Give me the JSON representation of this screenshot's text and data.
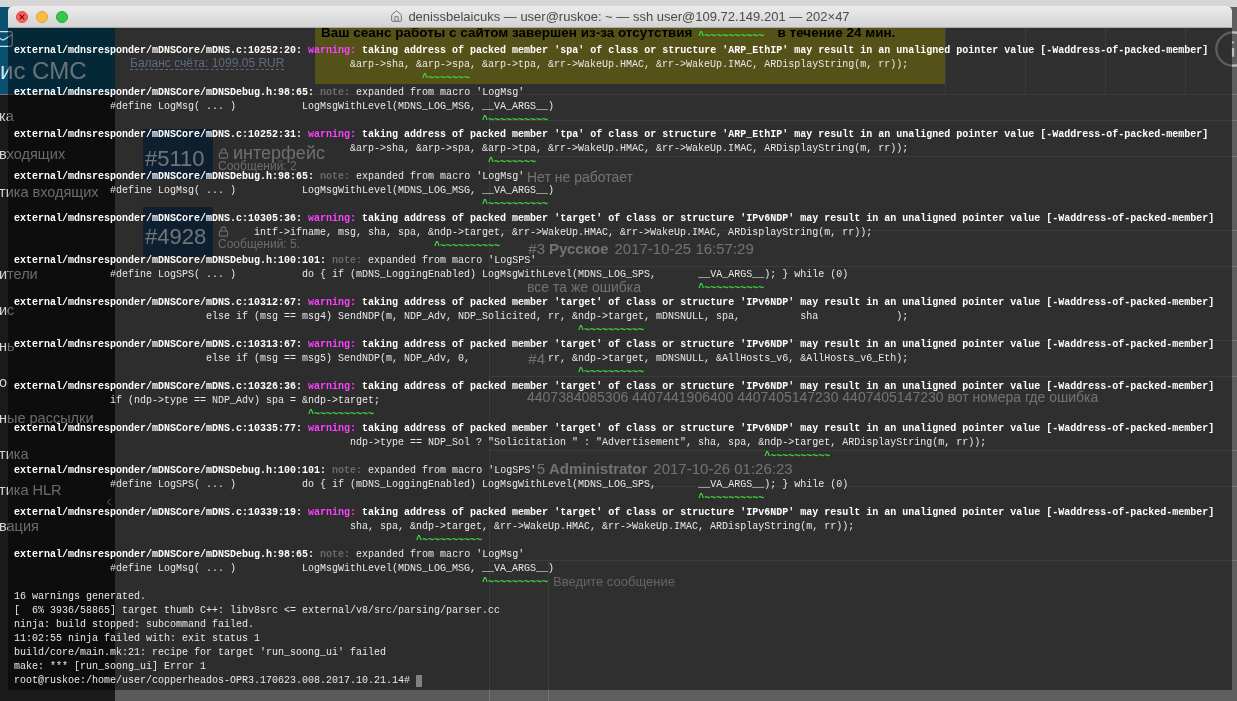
{
  "browser": {
    "logo": "ис СМС",
    "account": {
      "balance": "Баланс счёта: 1099.05 RUR"
    },
    "banner": {
      "texts": [
        "Ваш сеанс работы с сайтом завершен из-за отсутствия",
        "в течение 24 мин."
      ]
    },
    "sidebar": {
      "sections": [
        {
          "items": [
            "ка",
            "входящих",
            "тика входящих"
          ]
        },
        {
          "items": [
            "ители",
            "ис",
            "нь",
            "о",
            "ные рассылки",
            "тика",
            "тика HLR",
            "вация"
          ]
        }
      ]
    },
    "tickets": [
      {
        "number": "#5110",
        "title": "интерфейс",
        "locked": true,
        "count": "Сообщений: 2"
      },
      {
        "number": "#4928",
        "locked": true,
        "count": "Сообщений: 5."
      }
    ],
    "messages": [
      {
        "text": "Нет не работает"
      },
      {
        "number": "#3",
        "author": "Русское",
        "date": "2017-10-25 16:57:29",
        "text": "все та же ошибка"
      },
      {
        "number": "#4",
        "text": "4407384085306 4407441906400 4407405147230 4407405147230 вот номера где ошибка"
      },
      {
        "number": "5",
        "author": "Administrator",
        "date": "2017-10-26 01:26:23"
      }
    ],
    "composer": {
      "placeholder": "Введите сообщение"
    }
  },
  "terminal": {
    "title": "denissbelaicuks — user@ruskoe: ~ — ssh user@109.72.149.201 — 202×47",
    "lines": [
      {
        "kind": "caret",
        "text": "                                                                                                                  ^~~~~~~~~~~"
      },
      {
        "kind": "warning",
        "location": "external/mdnsresponder/mDNSCore/mDNS.c:10252:20:",
        "label": "warning:",
        "message": "taking address of packed member 'spa' of class or structure 'ARP_EthIP' may result in an unaligned pointer value [-Waddress-of-packed-member]"
      },
      {
        "kind": "code",
        "text": "                                                        &arp->sha, &arp->spa, &arp->tpa, &rr->WakeUp.HMAC, &rr->WakeUp.IMAC, ARDisplayString(m, rr));"
      },
      {
        "kind": "caret",
        "text": "                                                                    ^~~~~~~~"
      },
      {
        "kind": "note",
        "location": "external/mdnsresponder/mDNSCore/mDNSDebug.h:98:65:",
        "label": "note:",
        "message": "expanded from macro 'LogMsg'"
      },
      {
        "kind": "code",
        "text": "                #define LogMsg( ... )           LogMsgWithLevel(MDNS_LOG_MSG, __VA_ARGS__)"
      },
      {
        "kind": "caret",
        "text": "                                                                              ^~~~~~~~~~~"
      },
      {
        "kind": "warning",
        "location": "external/mdnsresponder/mDNSCore/mDNS.c:10252:31:",
        "label": "warning:",
        "message": "taking address of packed member 'tpa' of class or structure 'ARP_EthIP' may result in an unaligned pointer value [-Waddress-of-packed-member]"
      },
      {
        "kind": "code",
        "text": "                                                        &arp->sha, &arp->spa, &arp->tpa, &rr->WakeUp.HMAC, &rr->WakeUp.IMAC, ARDisplayString(m, rr));"
      },
      {
        "kind": "caret",
        "text": "                                                                               ^~~~~~~~"
      },
      {
        "kind": "note",
        "location": "external/mdnsresponder/mDNSCore/mDNSDebug.h:98:65:",
        "label": "note:",
        "message": "expanded from macro 'LogMsg'"
      },
      {
        "kind": "code",
        "text": "                #define LogMsg( ... )           LogMsgWithLevel(MDNS_LOG_MSG, __VA_ARGS__)"
      },
      {
        "kind": "caret",
        "text": "                                                                              ^~~~~~~~~~~"
      },
      {
        "kind": "warning",
        "location": "external/mdnsresponder/mDNSCore/mDNS.c:10305:36:",
        "label": "warning:",
        "message": "taking address of packed member 'target' of class or structure 'IPv6NDP' may result in an unaligned pointer value [-Waddress-of-packed-member]"
      },
      {
        "kind": "code",
        "text": "                                        intf->ifname, msg, sha, spa, &ndp->target, &rr->WakeUp.HMAC, &rr->WakeUp.IMAC, ARDisplayString(m, rr));"
      },
      {
        "kind": "caret",
        "text": "                                                                      ^~~~~~~~~~~"
      },
      {
        "kind": "note",
        "location": "external/mdnsresponder/mDNSCore/mDNSDebug.h:100:101:",
        "label": "note:",
        "message": "expanded from macro 'LogSPS'"
      },
      {
        "kind": "code",
        "text": "                #define LogSPS( ... )           do { if (mDNS_LoggingEnabled) LogMsgWithLevel(MDNS_LOG_SPS,       __VA_ARGS__); } while (0)"
      },
      {
        "kind": "caret",
        "text": "                                                                                                                  ^~~~~~~~~~~"
      },
      {
        "kind": "warning",
        "location": "external/mdnsresponder/mDNSCore/mDNS.c:10312:67:",
        "label": "warning:",
        "message": "taking address of packed member 'target' of class or structure 'IPv6NDP' may result in an unaligned pointer value [-Waddress-of-packed-member]"
      },
      {
        "kind": "code",
        "text": "                                else if (msg == msg4) SendNDP(m, NDP_Adv, NDP_Solicited, rr, &ndp->target, mDNSNULL, spa,          sha             );"
      },
      {
        "kind": "caret",
        "text": "                                                                                              ^~~~~~~~~~~"
      },
      {
        "kind": "warning",
        "location": "external/mdnsresponder/mDNSCore/mDNS.c:10313:67:",
        "label": "warning:",
        "message": "taking address of packed member 'target' of class or structure 'IPv6NDP' may result in an unaligned pointer value [-Waddress-of-packed-member]"
      },
      {
        "kind": "code",
        "text": "                                else if (msg == msg5) SendNDP(m, NDP_Adv, 0,             rr, &ndp->target, mDNSNULL, &AllHosts_v6, &AllHosts_v6_Eth);"
      },
      {
        "kind": "caret",
        "text": "                                                                                              ^~~~~~~~~~~"
      },
      {
        "kind": "warning",
        "location": "external/mdnsresponder/mDNSCore/mDNS.c:10326:36:",
        "label": "warning:",
        "message": "taking address of packed member 'target' of class or structure 'IPv6NDP' may result in an unaligned pointer value [-Waddress-of-packed-member]"
      },
      {
        "kind": "code",
        "text": "                if (ndp->type == NDP_Adv) spa = &ndp->target;"
      },
      {
        "kind": "caret",
        "text": "                                                 ^~~~~~~~~~~"
      },
      {
        "kind": "warning",
        "location": "external/mdnsresponder/mDNSCore/mDNS.c:10335:77:",
        "label": "warning:",
        "message": "taking address of packed member 'target' of class or structure 'IPv6NDP' may result in an unaligned pointer value [-Waddress-of-packed-member]"
      },
      {
        "kind": "code",
        "text": "                                                        ndp->type == NDP_Sol ? \"Solicitation \" : \"Advertisement\", sha, spa, &ndp->target, ARDisplayString(m, rr));"
      },
      {
        "kind": "caret",
        "text": "                                                                                                                             ^~~~~~~~~~~"
      },
      {
        "kind": "note",
        "location": "external/mdnsresponder/mDNSCore/mDNSDebug.h:100:101:",
        "label": "note:",
        "message": "expanded from macro 'LogSPS'"
      },
      {
        "kind": "code",
        "text": "                #define LogSPS( ... )           do { if (mDNS_LoggingEnabled) LogMsgWithLevel(MDNS_LOG_SPS,       __VA_ARGS__); } while (0)"
      },
      {
        "kind": "caret",
        "text": "                                                                                                                  ^~~~~~~~~~~"
      },
      {
        "kind": "warning",
        "location": "external/mdnsresponder/mDNSCore/mDNS.c:10339:19:",
        "label": "warning:",
        "message": "taking address of packed member 'target' of class or structure 'IPv6NDP' may result in an unaligned pointer value [-Waddress-of-packed-member]"
      },
      {
        "kind": "code",
        "text": "                                                        sha, spa, &ndp->target, &rr->WakeUp.HMAC, &rr->WakeUp.IMAC, ARDisplayString(m, rr));"
      },
      {
        "kind": "caret",
        "text": "                                                                   ^~~~~~~~~~~"
      },
      {
        "kind": "note",
        "location": "external/mdnsresponder/mDNSCore/mDNSDebug.h:98:65:",
        "label": "note:",
        "message": "expanded from macro 'LogMsg'"
      },
      {
        "kind": "code",
        "text": "                #define LogMsg( ... )           LogMsgWithLevel(MDNS_LOG_MSG, __VA_ARGS__)"
      },
      {
        "kind": "caret",
        "text": "                                                                              ^~~~~~~~~~~"
      },
      {
        "kind": "output",
        "text": "16 warnings generated."
      },
      {
        "kind": "output",
        "text": "[  6% 3936/58865] target thumb C++: libv8src <= external/v8/src/parsing/parser.cc"
      },
      {
        "kind": "output",
        "text": "ninja: build stopped: subcommand failed."
      },
      {
        "kind": "output",
        "text": "11:02:55 ninja failed with: exit status 1"
      },
      {
        "kind": "output",
        "text": "build/core/main.mk:21: recipe for target 'run_soong_ui' failed"
      },
      {
        "kind": "output",
        "text": "make: *** [run_soong_ui] Error 1"
      },
      {
        "kind": "prompt",
        "text": "root@ruskoe:/home/user/copperheados-OPR3.170623.008.2017.10.21.14#"
      }
    ]
  }
}
